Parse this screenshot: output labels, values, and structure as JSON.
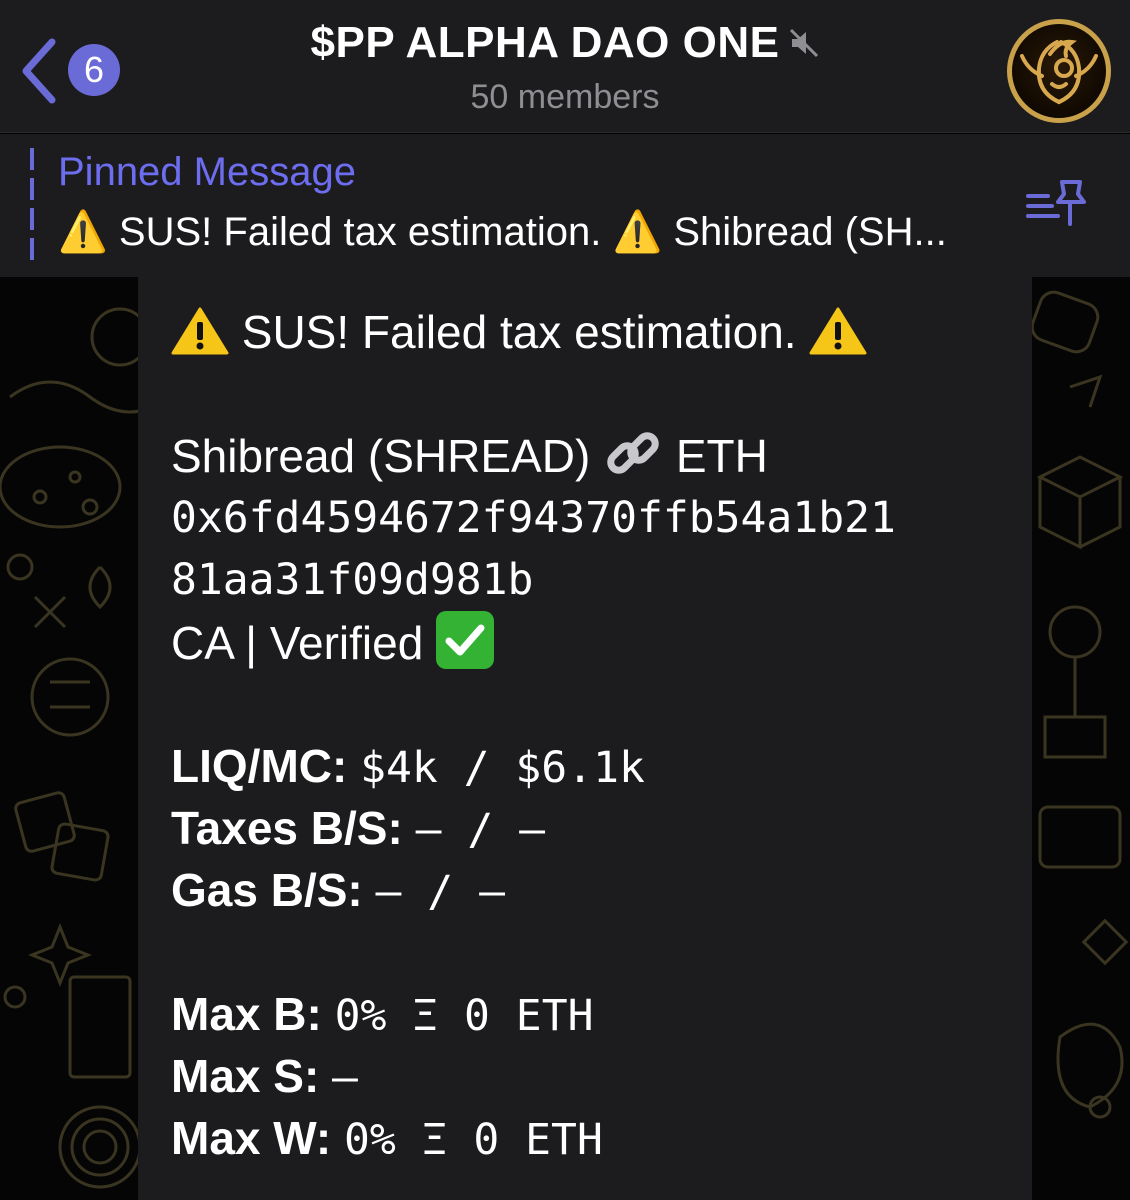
{
  "header": {
    "back_badge": "6",
    "title": "$PP ALPHA DAO ONE",
    "members": "50 members",
    "muted_icon": "speaker-muted-icon",
    "back_icon": "chevron-left-icon",
    "avatar_icon": "phoenix-logo"
  },
  "pinned": {
    "label": "Pinned Message",
    "preview": "⚠️ SUS! Failed tax estimation. ⚠️ Shibread (SH...",
    "icon": "pinned-list-icon"
  },
  "message": {
    "warning_text": "SUS! Failed tax estimation.",
    "token_line": "Shibread (SHREAD)",
    "chain": "ETH",
    "address_line1": "0x6fd4594672f94370ffb54a1b21",
    "address_line2": "81aa31f09d981b",
    "ca_verified": "CA | Verified",
    "liq_label": "LIQ/MC:",
    "liq_value": "$4k / $6.1k",
    "taxes_label": "Taxes B/S:",
    "taxes_value": "– / –",
    "gas_label": "Gas B/S:",
    "gas_value": "– / –",
    "maxb_label": "Max B:",
    "maxb_value": "0% Ξ 0 ETH",
    "maxs_label": "Max S:",
    "maxs_value": "–",
    "maxw_label": "Max W:",
    "maxw_value": "0% Ξ 0 ETH"
  },
  "colors": {
    "accent": "#6b6bd8",
    "header_bg": "#1c1c1e",
    "bubble_bg": "#1c1c1e",
    "check_green": "#34b233",
    "warning_yellow": "#f5c518"
  }
}
